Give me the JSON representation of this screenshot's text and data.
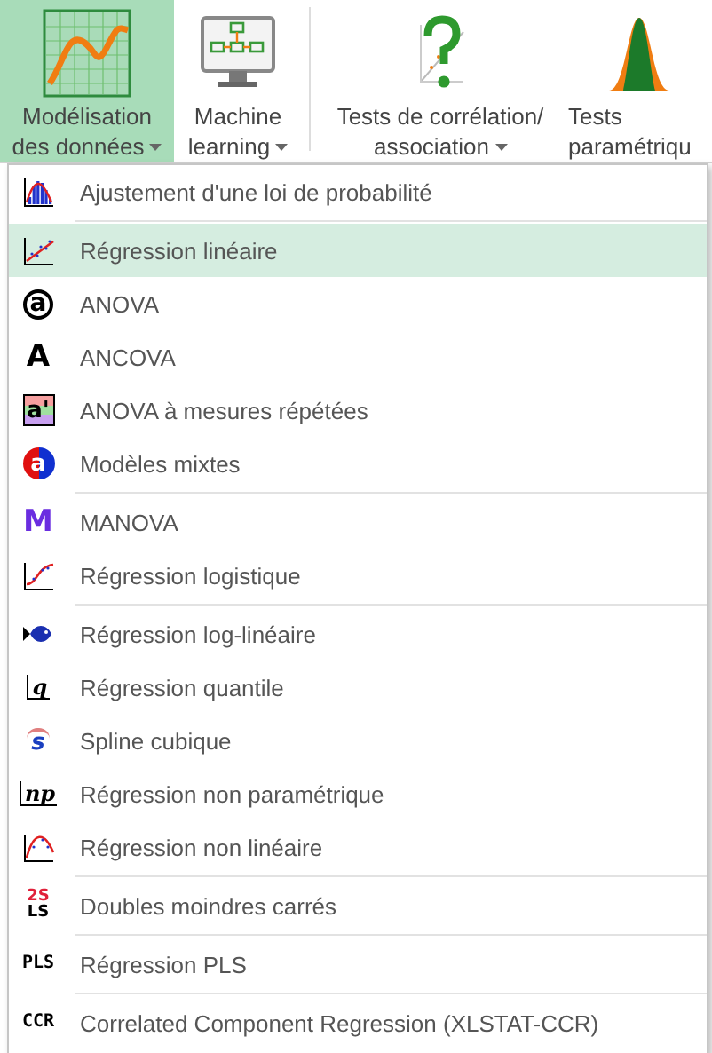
{
  "ribbon": [
    {
      "lines": [
        "Modélisation",
        "des données"
      ],
      "dropdown": true,
      "selected": true
    },
    {
      "lines": [
        "Machine",
        "learning"
      ],
      "dropdown": true,
      "selected": false
    },
    {
      "lines": [
        "Tests de corrélation/",
        "association"
      ],
      "dropdown": true,
      "selected": false
    },
    {
      "lines": [
        "Tests",
        "paramétriqu"
      ],
      "dropdown": false,
      "selected": false
    }
  ],
  "menu": {
    "groups": [
      [
        {
          "label": "Ajustement d'une loi de probabilité",
          "selected": false
        }
      ],
      [
        {
          "label": "Régression linéaire",
          "selected": true
        },
        {
          "glyph": "a",
          "label": "ANOVA",
          "selected": false
        },
        {
          "glyph": "A",
          "label": "ANCOVA",
          "selected": false
        },
        {
          "glyph": "a'",
          "label": "ANOVA à mesures répétées",
          "selected": false
        },
        {
          "glyph": "a",
          "label": "Modèles mixtes",
          "selected": false
        }
      ],
      [
        {
          "glyph": "M",
          "label": "MANOVA",
          "selected": false
        },
        {
          "label": "Régression logistique",
          "selected": false
        }
      ],
      [
        {
          "label": "Régression log-linéaire",
          "selected": false
        },
        {
          "glyph": "q",
          "label": "Régression quantile",
          "selected": false
        },
        {
          "glyph": "s",
          "label": "Spline cubique",
          "selected": false
        },
        {
          "glyph": "np",
          "label": "Régression non paramétrique",
          "selected": false
        },
        {
          "label": "Régression non linéaire",
          "selected": false
        }
      ],
      [
        {
          "glyph": "2S",
          "glyph2": "LS",
          "label": "Doubles moindres carrés",
          "selected": false
        }
      ],
      [
        {
          "glyph": "PLS",
          "label": "Régression PLS",
          "selected": false
        }
      ],
      [
        {
          "glyph": "CCR",
          "label": "Correlated Component Regression (XLSTAT-CCR)",
          "selected": false
        }
      ]
    ]
  }
}
